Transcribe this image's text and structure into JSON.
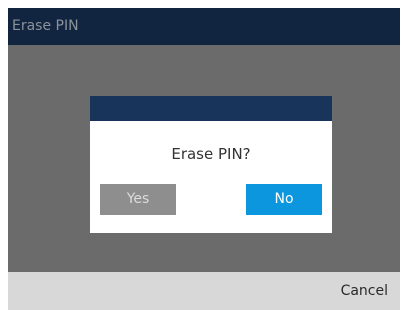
{
  "window": {
    "title": "Erase PIN"
  },
  "dialog": {
    "message": "Erase PIN?",
    "yes_label": "Yes",
    "no_label": "No"
  },
  "softkeys": {
    "cancel_label": "Cancel"
  },
  "colors": {
    "title_bar": "#122540",
    "backdrop": "#6b6b6b",
    "dialog_header": "#19345a",
    "primary_button": "#0c96dd",
    "secondary_button": "#8e8e8e",
    "softkey_bar": "#d8d8d8"
  }
}
